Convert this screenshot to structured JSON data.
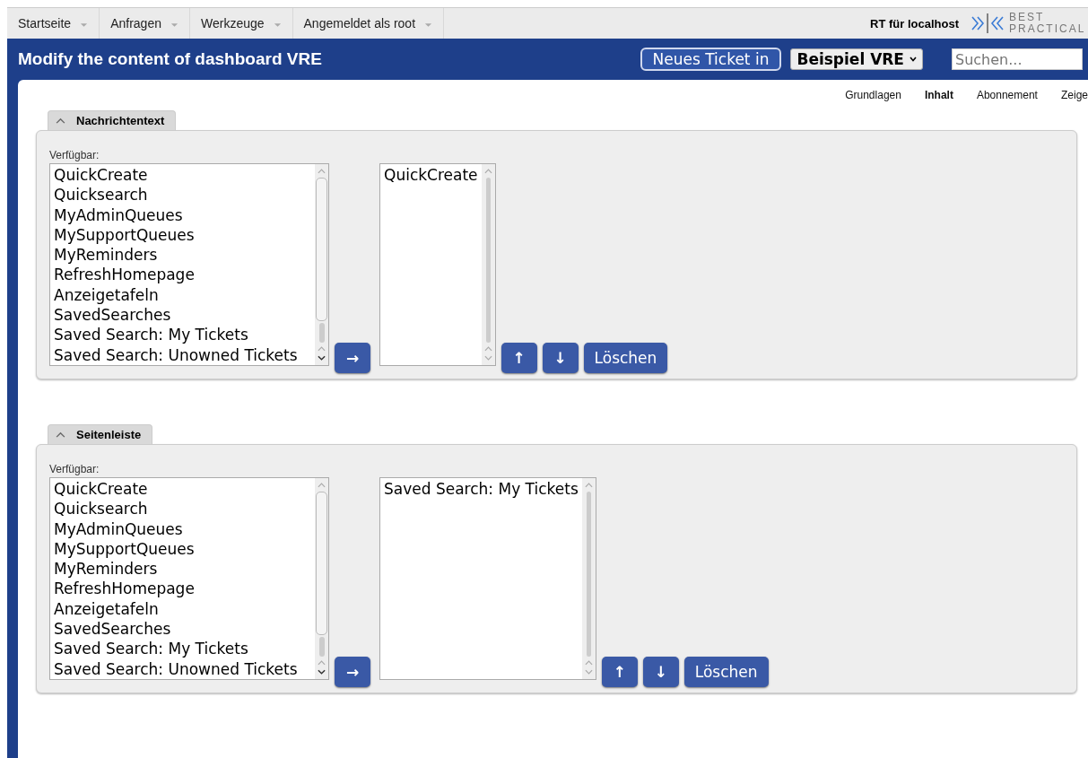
{
  "menu": [
    {
      "label": "Startseite"
    },
    {
      "label": "Anfragen"
    },
    {
      "label": "Werkzeuge"
    },
    {
      "label": "Angemeldet als root"
    }
  ],
  "brand": "RT für localhost",
  "logo": [
    "BEST",
    "PRACTICAL"
  ],
  "header": {
    "title": "Modify the content of dashboard VRE",
    "new_ticket_button": "Neues Ticket in",
    "queue_select": "Beispiel VRE",
    "search": {
      "placeholder": "Suchen..."
    }
  },
  "tabs": [
    {
      "label": "Grundlagen",
      "selected": false
    },
    {
      "label": "Inhalt",
      "selected": true
    },
    {
      "label": "Abonnement",
      "selected": false
    },
    {
      "label": "Zeige",
      "selected": false
    }
  ],
  "sections": [
    {
      "title": "Nachrichtentext",
      "expanded": true,
      "available_label": "Verfügbar:",
      "available": [
        "QuickCreate",
        "Quicksearch",
        "MyAdminQueues",
        "MySupportQueues",
        "MyReminders",
        "RefreshHomepage",
        "Anzeigetafeln",
        "SavedSearches",
        "Saved Search: My Tickets",
        "Saved Search: Unowned Tickets"
      ],
      "chosen": [
        "QuickCreate"
      ],
      "add_button": "→",
      "up_button": "↑",
      "down_button": "↓",
      "delete_button": "Löschen"
    },
    {
      "title": "Seitenleiste",
      "expanded": true,
      "available_label": "Verfügbar:",
      "available": [
        "QuickCreate",
        "Quicksearch",
        "MyAdminQueues",
        "MySupportQueues",
        "MyReminders",
        "RefreshHomepage",
        "Anzeigetafeln",
        "SavedSearches",
        "Saved Search: My Tickets",
        "Saved Search: Unowned Tickets"
      ],
      "chosen": [
        "Saved Search: My Tickets"
      ],
      "add_button": "→",
      "up_button": "↑",
      "down_button": "↓",
      "delete_button": "Löschen"
    }
  ]
}
